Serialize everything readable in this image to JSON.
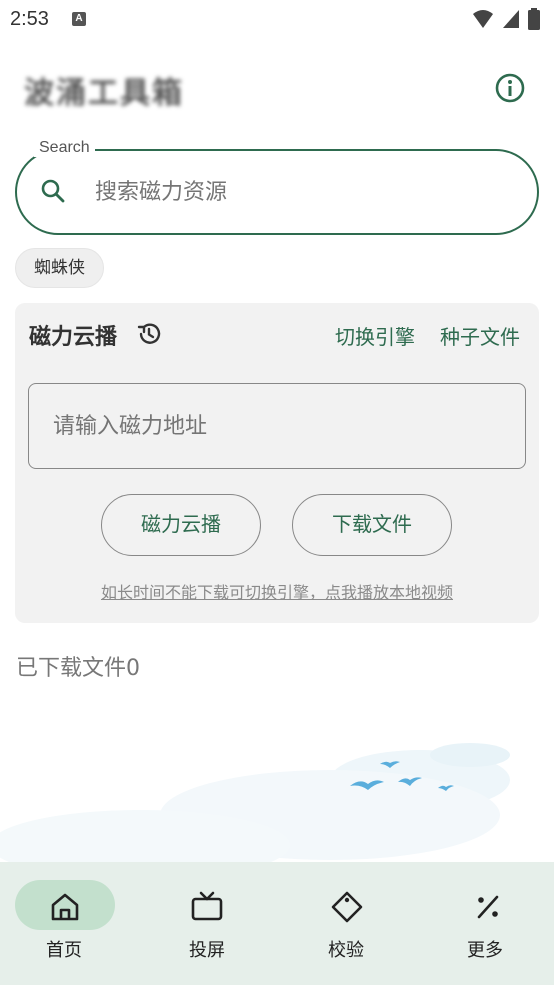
{
  "status_bar": {
    "time": "2:53",
    "notification_icon": "A"
  },
  "header": {
    "title": "波涌工具箱",
    "info_icon": "info-icon"
  },
  "search": {
    "label": "Search",
    "placeholder": "搜索磁力资源"
  },
  "chips": [
    "蜘蛛侠"
  ],
  "card": {
    "title": "磁力云播",
    "links": {
      "switch_engine": "切换引擎",
      "torrent_file": "种子文件"
    },
    "input_placeholder": "请输入磁力地址",
    "buttons": {
      "cloud_play": "磁力云播",
      "download_file": "下载文件"
    },
    "hint": "如长时间不能下载可切换引擎，点我播放本地视频"
  },
  "downloaded_label": "已下载文件0",
  "nav": {
    "items": [
      {
        "label": "首页",
        "icon": "home-icon",
        "active": true
      },
      {
        "label": "投屏",
        "icon": "tv-icon",
        "active": false
      },
      {
        "label": "校验",
        "icon": "tag-icon",
        "active": false
      },
      {
        "label": "更多",
        "icon": "percent-icon",
        "active": false
      }
    ]
  },
  "colors": {
    "accent": "#2e6b4f",
    "nav_bg": "#e6efea",
    "nav_active_pill": "#c3e0cd",
    "card_bg": "#f2f2f2"
  }
}
